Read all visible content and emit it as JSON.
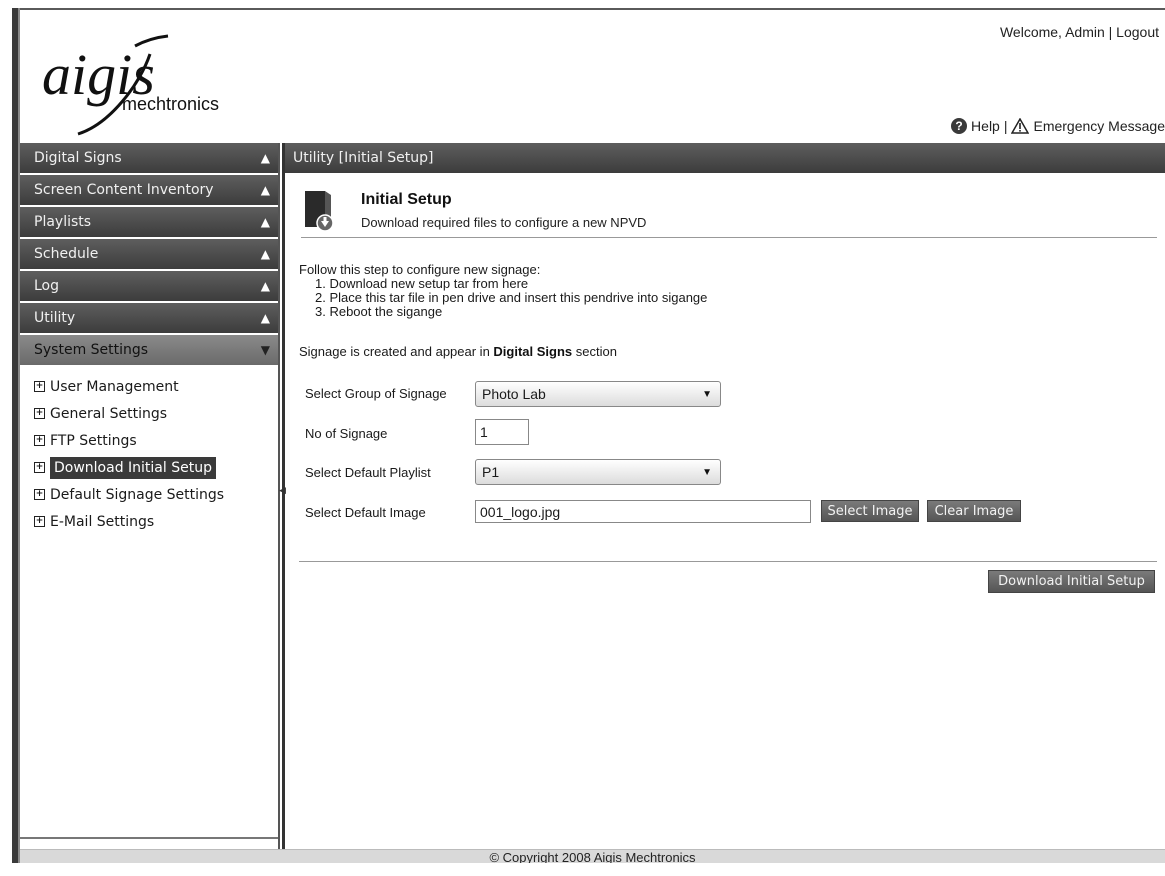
{
  "header": {
    "logo_main": "aigis",
    "logo_sub": "mechtronics",
    "welcome_text": "Welcome, Admin | ",
    "logout_label": "Logout",
    "help_label": "Help",
    "separator": "|",
    "emergency_label": "Emergency Message"
  },
  "sidebar": {
    "sections": [
      {
        "label": "Digital Signs"
      },
      {
        "label": "Screen Content Inventory"
      },
      {
        "label": "Playlists"
      },
      {
        "label": "Schedule"
      },
      {
        "label": "Log"
      },
      {
        "label": "Utility"
      },
      {
        "label": "System Settings"
      }
    ],
    "subitems": [
      {
        "label": "User Management"
      },
      {
        "label": "General Settings"
      },
      {
        "label": "FTP Settings"
      },
      {
        "label": "Download Initial Setup"
      },
      {
        "label": "Default Signage Settings"
      },
      {
        "label": "E-Mail Settings"
      }
    ]
  },
  "main": {
    "panel_title": "Utility [Initial Setup]",
    "page_title": "Initial Setup",
    "page_subtitle": "Download required files to configure a new NPVD",
    "intro": "Follow this step to configure new signage:",
    "steps": [
      "1. Download new setup tar from here",
      "2. Place this tar file in pen drive and insert this pendrive into sigange",
      "3. Reboot the sigange"
    ],
    "note_prefix": "Signage is created and appear in ",
    "note_bold": "Digital Signs",
    "note_suffix": " section",
    "form": {
      "group_label": "Select Group of Signage",
      "group_value": "Photo Lab",
      "count_label": "No of Signage",
      "count_value": "1",
      "playlist_label": "Select Default Playlist",
      "playlist_value": "P1",
      "image_label": "Select Default Image",
      "image_value": "001_logo.jpg",
      "select_image_button": "Select Image",
      "clear_image_button": "Clear Image"
    },
    "download_button": "Download Initial Setup"
  },
  "footer": {
    "copyright": "© Copyright 2008 Aigis Mechtronics"
  }
}
